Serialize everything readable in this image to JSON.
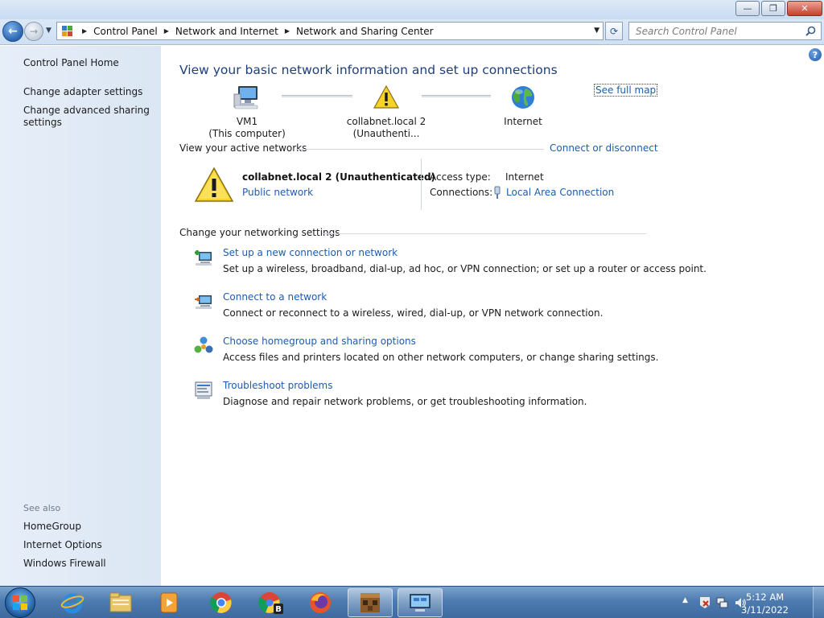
{
  "window": {
    "minimize_glyph": "—",
    "maximize_glyph": "❐",
    "close_glyph": "✕"
  },
  "nav": {
    "back_glyph": "←",
    "forward_glyph": "→",
    "breadcrumbs": [
      "Control Panel",
      "Network and Internet",
      "Network and Sharing Center"
    ],
    "refresh_glyph": "⟳",
    "search_placeholder": "Search Control Panel"
  },
  "sidebar": {
    "items": [
      "Control Panel Home",
      "Change adapter settings",
      "Change advanced sharing settings"
    ],
    "see_also_label": "See also",
    "see_also": [
      "HomeGroup",
      "Internet Options",
      "Windows Firewall"
    ]
  },
  "main": {
    "help_glyph": "?",
    "title": "View your basic network information and set up connections",
    "see_full_map": "See full map",
    "map": {
      "computer_name": "VM1",
      "computer_sub": "(This computer)",
      "network_name": "collabnet.local  2 (Unauthenti...",
      "internet_label": "Internet"
    },
    "active_networks": {
      "heading": "View your active networks",
      "connect_link": "Connect or disconnect",
      "network_name": "collabnet.local  2 (Unauthenticated)",
      "network_type": "Public network",
      "access_type_label": "Access type:",
      "access_type_value": "Internet",
      "connections_label": "Connections:",
      "connections_value": "Local Area Connection"
    },
    "networking_settings": {
      "heading": "Change your networking settings",
      "tasks": [
        {
          "link": "Set up a new connection or network",
          "desc": "Set up a wireless, broadband, dial-up, ad hoc, or VPN connection; or set up a router or access point."
        },
        {
          "link": "Connect to a network",
          "desc": "Connect or reconnect to a wireless, wired, dial-up, or VPN network connection."
        },
        {
          "link": "Choose homegroup and sharing options",
          "desc": "Access files and printers located on other network computers, or change sharing settings."
        },
        {
          "link": "Troubleshoot problems",
          "desc": "Diagnose and repair network problems, or get troubleshooting information."
        }
      ]
    }
  },
  "taskbar": {
    "apps": [
      "internet-explorer-icon",
      "file-explorer-icon",
      "media-player-icon",
      "chrome-icon",
      "chrome-profile-icon",
      "firefox-icon",
      "minecraft-icon",
      "network-control-panel-icon"
    ],
    "time": "5:12 AM",
    "date": "3/11/2022"
  },
  "colors": {
    "link": "#1e5bb0",
    "title": "#1e3f7a",
    "sidebar_bg": "#e3ecf7",
    "taskbar": "#4d7bb0"
  }
}
